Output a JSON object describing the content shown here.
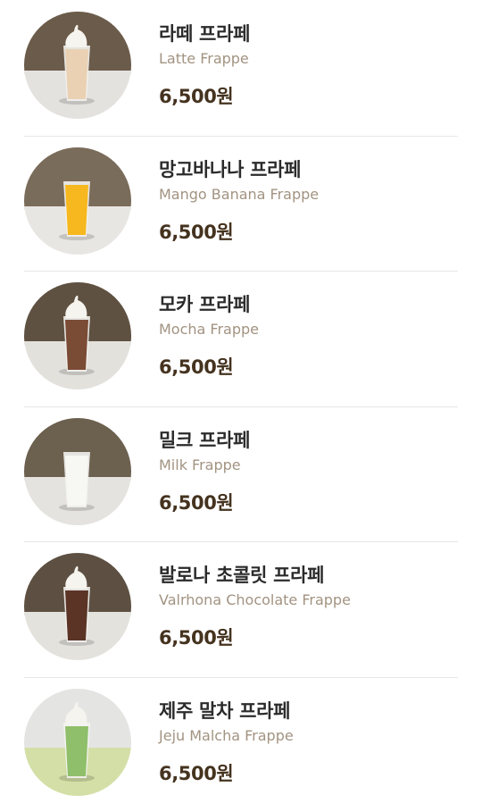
{
  "menu": {
    "items": [
      {
        "name_ko": "라떼 프라페",
        "name_en": "Latte Frappe",
        "price": "6,500원",
        "image": "latte-frappe-photo",
        "drink_color": "#ead1b4",
        "topping": "whipped-cream",
        "backdrop": "#6b5b4a",
        "table": "#e4e2de"
      },
      {
        "name_ko": "망고바나나 프라페",
        "name_en": "Mango Banana Frappe",
        "price": "6,500원",
        "image": "mango-banana-frappe-photo",
        "drink_color": "#f6b81e",
        "topping": "none",
        "backdrop": "#7a6c5a",
        "table": "#e8e6e2"
      },
      {
        "name_ko": "모카 프라페",
        "name_en": "Mocha Frappe",
        "price": "6,500원",
        "image": "mocha-frappe-photo",
        "drink_color": "#7a4b35",
        "topping": "whipped-cream",
        "backdrop": "#5f5141",
        "table": "#e3e1dc"
      },
      {
        "name_ko": "밀크 프라페",
        "name_en": "Milk Frappe",
        "price": "6,500원",
        "image": "milk-frappe-photo",
        "drink_color": "#f7f7f4",
        "topping": "none",
        "backdrop": "#6c604f",
        "table": "#e5e3df"
      },
      {
        "name_ko": "발로나 초콜릿 프라페",
        "name_en": "Valrhona Chocolate Frappe",
        "price": "6,500원",
        "image": "valrhona-chocolate-frappe-photo",
        "drink_color": "#5b3426",
        "topping": "whipped-cream",
        "backdrop": "#5d5042",
        "table": "#e4e2dd"
      },
      {
        "name_ko": "제주 말차 프라페",
        "name_en": "Jeju Malcha Frappe",
        "price": "6,500원",
        "image": "jeju-malcha-frappe-photo",
        "drink_color": "#8fbf6a",
        "topping": "whipped-cream",
        "backdrop": "#e4e5e3",
        "table": "#d3dfa6"
      }
    ]
  }
}
